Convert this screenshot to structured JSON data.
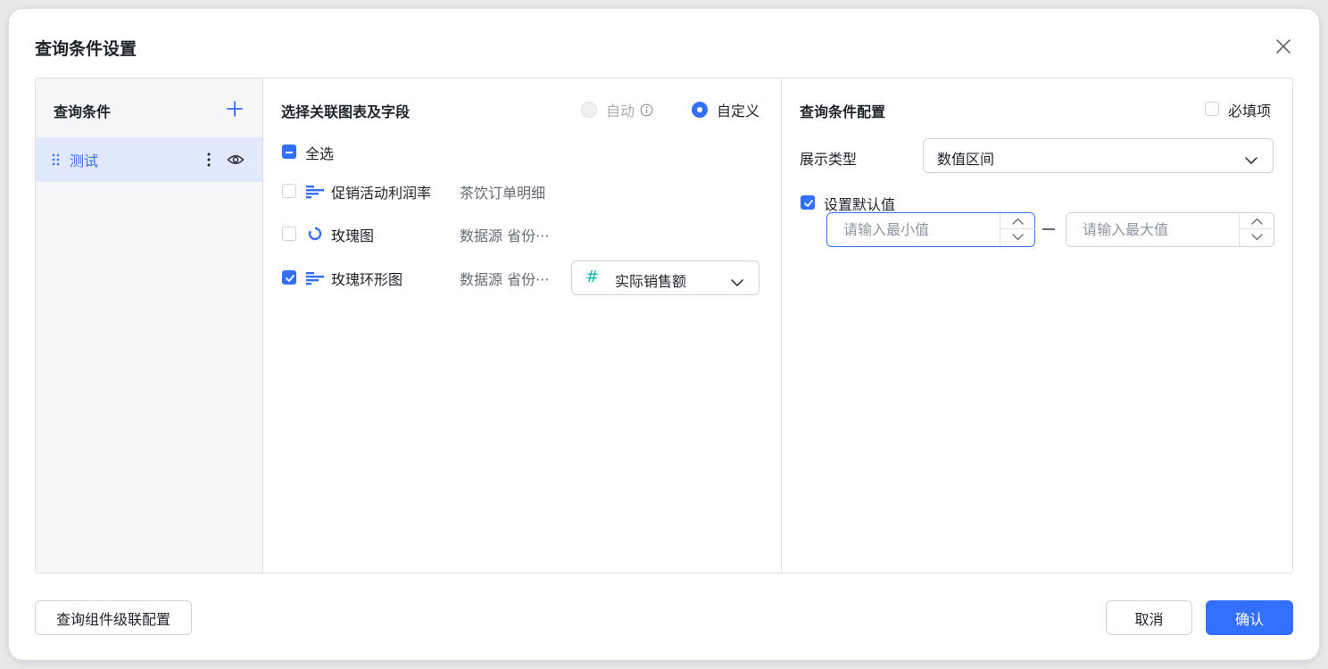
{
  "dialog": {
    "title": "查询条件设置"
  },
  "left": {
    "title": "查询条件",
    "items": [
      {
        "label": "测试"
      }
    ]
  },
  "middle": {
    "title": "选择关联图表及字段",
    "mode_auto": "自动",
    "mode_custom": "自定义",
    "selected_mode": "自定义",
    "select_all": "全选",
    "rows": [
      {
        "chart": "促销活动利润率",
        "source": "茶饮订单明细",
        "checked": false,
        "icon": "bar-chart-icon"
      },
      {
        "chart": "玫瑰图",
        "source": "数据源 省份···",
        "checked": false,
        "icon": "ring-chart-icon"
      },
      {
        "chart": "玫瑰环形图",
        "source": "数据源 省份···",
        "checked": true,
        "icon": "bar-chart-icon",
        "field": "实际销售额"
      }
    ]
  },
  "right": {
    "title": "查询条件配置",
    "required_label": "必填项",
    "display_type_label": "展示类型",
    "display_type_value": "数值区间",
    "default_value_label": "设置默认值",
    "min_placeholder": "请输入最小值",
    "max_placeholder": "请输入最大值"
  },
  "footer": {
    "cascade_button": "查询组件级联配置",
    "cancel_button": "取消",
    "confirm_button": "确认"
  },
  "colors": {
    "accent": "#3370ff",
    "field_hash": "#14b8a6"
  }
}
